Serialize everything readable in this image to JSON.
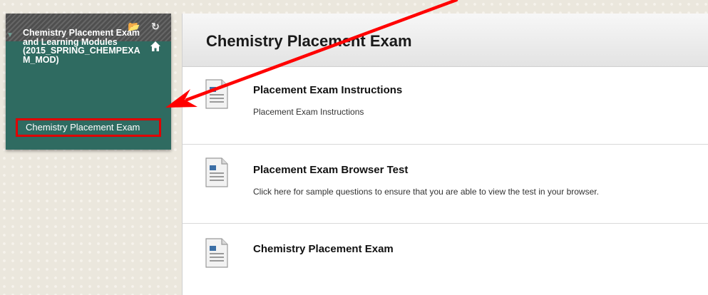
{
  "course_menu": {
    "toolbar": {
      "folder_icon": "folder-icon",
      "refresh_icon": "refresh-icon"
    },
    "course_title": "Chemistry Placement Exam and Learning Modules (2015_SPRING_CHEMPEXAM_MOD)",
    "home_icon": "home-icon",
    "items": [
      {
        "label": "Chemistry Placement Exam"
      }
    ]
  },
  "main": {
    "page_title": "Chemistry Placement Exam",
    "items": [
      {
        "title": "Placement Exam Instructions",
        "description": "Placement Exam Instructions",
        "icon": "document-icon"
      },
      {
        "title": "Placement Exam Browser Test",
        "description": "Click here for sample questions to ensure that you are able to view the test in your browser.",
        "icon": "document-icon"
      },
      {
        "title": "Chemistry Placement Exam",
        "description": "",
        "icon": "document-icon"
      }
    ]
  },
  "colors": {
    "menu_bg": "#2f6b61",
    "highlight": "#e00000",
    "arrow": "#ff0000"
  }
}
